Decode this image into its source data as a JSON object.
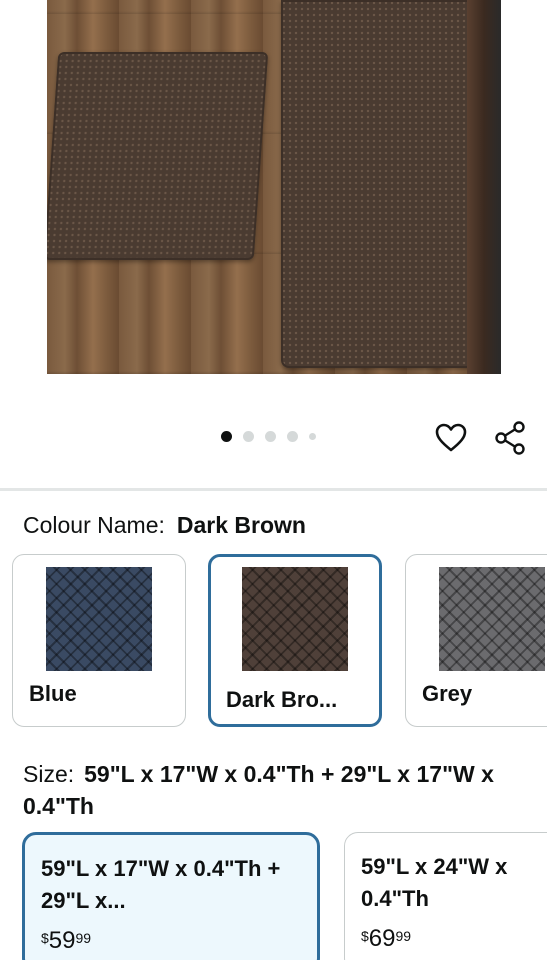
{
  "carousel": {
    "count": 5,
    "active_index": 0
  },
  "colour": {
    "label": "Colour Name:",
    "selected": "Dark Brown",
    "options": [
      {
        "label": "Blue",
        "color": "#3a4a63",
        "selected": false
      },
      {
        "label": "Dark Bro...",
        "color": "#4f4039",
        "selected": true
      },
      {
        "label": "Grey",
        "color": "#6b6b6e",
        "selected": false
      }
    ]
  },
  "size": {
    "label": "Size:",
    "selected": "59\"L x 17\"W x 0.4\"Th + 29\"L x 17\"W x 0.4\"Th",
    "options": [
      {
        "name": "59\"L x 17\"W x 0.4\"Th + 29\"L x...",
        "price_symbol": "$",
        "price_whole": "59",
        "price_fraction": "99",
        "selected": true
      },
      {
        "name": "59\"L x 24\"W x 0.4\"Th",
        "price_symbol": "$",
        "price_whole": "69",
        "price_fraction": "99",
        "selected": false
      }
    ]
  },
  "icons": {
    "favorite": "heart-icon",
    "share": "share-icon"
  },
  "colors": {
    "selected_border": "#2f6d9b",
    "selected_background": "#edf8fd"
  }
}
